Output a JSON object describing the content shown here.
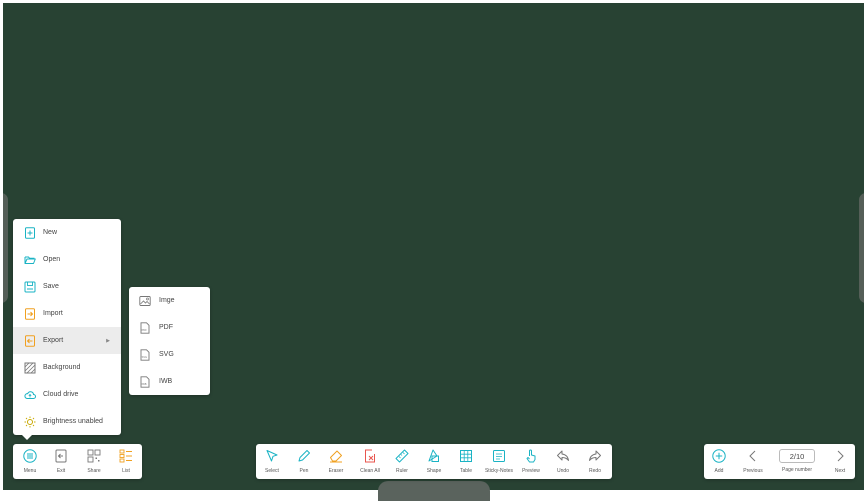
{
  "menu": {
    "items": [
      {
        "label": "New",
        "icon": "new-file-icon"
      },
      {
        "label": "Open",
        "icon": "folder-open-icon"
      },
      {
        "label": "Save",
        "icon": "save-icon"
      },
      {
        "label": "Import",
        "icon": "import-icon"
      },
      {
        "label": "Export",
        "icon": "export-icon",
        "has_submenu": true,
        "active": true
      },
      {
        "label": "Background",
        "icon": "background-icon"
      },
      {
        "label": "Cloud drive",
        "icon": "cloud-icon"
      },
      {
        "label": "Brightness unabled",
        "icon": "brightness-icon"
      }
    ]
  },
  "export_submenu": {
    "items": [
      {
        "label": "Imge",
        "icon": "image-icon"
      },
      {
        "label": "PDF",
        "icon": "pdf-file-icon",
        "badge": "PDF"
      },
      {
        "label": "SVG",
        "icon": "svg-file-icon",
        "badge": "SVG"
      },
      {
        "label": "IWB",
        "icon": "iwb-file-icon",
        "badge": "IWB"
      }
    ]
  },
  "left_toolbar": {
    "items": [
      {
        "label": "Menu",
        "icon": "menu-icon"
      },
      {
        "label": "Exit",
        "icon": "exit-icon"
      },
      {
        "label": "Share",
        "icon": "qr-share-icon"
      },
      {
        "label": "List",
        "icon": "list-icon"
      }
    ]
  },
  "center_toolbar": {
    "items": [
      {
        "label": "Select",
        "icon": "cursor-icon"
      },
      {
        "label": "Pen",
        "icon": "pen-icon"
      },
      {
        "label": "Eraser",
        "icon": "eraser-icon"
      },
      {
        "label": "Clean All",
        "icon": "clean-all-icon"
      },
      {
        "label": "Ruler",
        "icon": "ruler-icon"
      },
      {
        "label": "Shape",
        "icon": "shape-icon"
      },
      {
        "label": "Table",
        "icon": "table-icon"
      },
      {
        "label": "Sticky-Notes",
        "icon": "sticky-note-icon"
      },
      {
        "label": "Preview",
        "icon": "preview-icon"
      },
      {
        "label": "Undo",
        "icon": "undo-icon"
      },
      {
        "label": "Redo",
        "icon": "redo-icon"
      }
    ]
  },
  "right_toolbar": {
    "add_label": "Add",
    "previous_label": "Previous",
    "page_label": "Page number",
    "page_value": "2/10",
    "next_label": "Next"
  },
  "colors": {
    "board": "#284233",
    "accent_teal": "#1ab3c4",
    "accent_orange": "#f0a020",
    "accent_red": "#e8554e"
  }
}
